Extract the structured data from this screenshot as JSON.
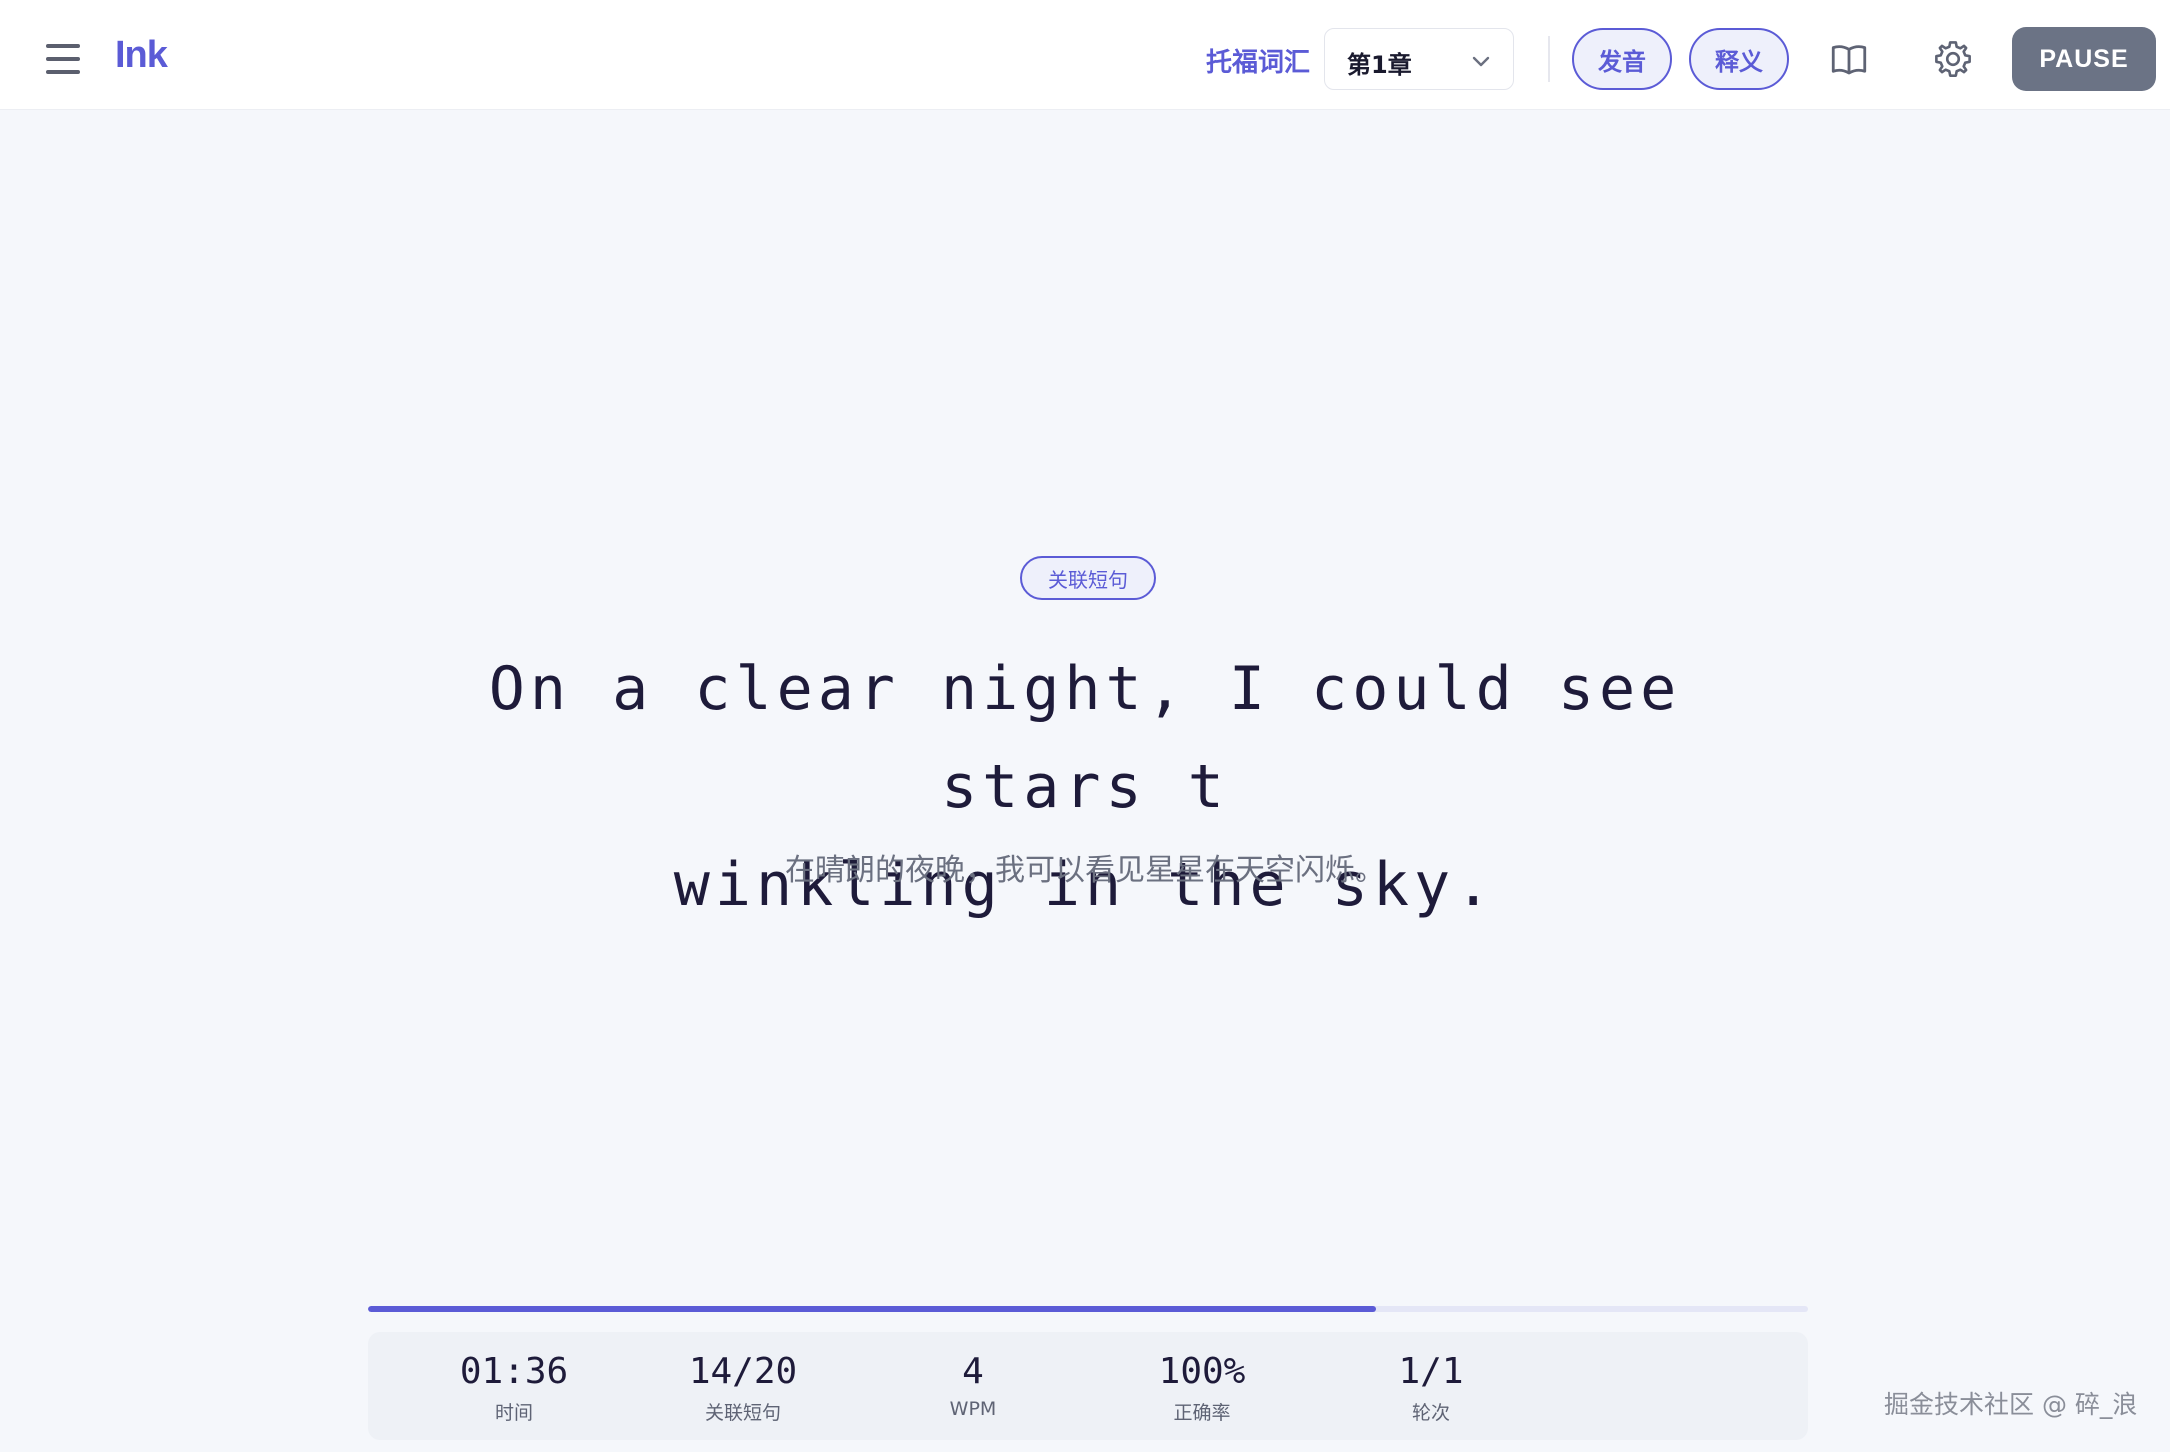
{
  "header": {
    "logo": "Ink",
    "wordbook_label": "托福词汇",
    "chapter_select": {
      "value": "第1章"
    },
    "pronounce_label": "发音",
    "definition_label": "释义",
    "pause_label": "PAUSE"
  },
  "main": {
    "tag": "关联短句",
    "sentence_line1": "On a clear night, I could see stars t",
    "sentence_line2": "winkling in the sky.",
    "translation": "在晴朗的夜晚，我可以看见星星在天空闪烁。"
  },
  "progress": {
    "fraction": 0.7
  },
  "stats": [
    {
      "value": "01:36",
      "label": "时间"
    },
    {
      "value": "14/20",
      "label": "关联短句"
    },
    {
      "value": "4",
      "label": "WPM"
    },
    {
      "value": "100%",
      "label": "正确率"
    },
    {
      "value": "1/1",
      "label": "轮次"
    }
  ],
  "watermark": "掘金技术社区 @ 碎_浪",
  "colors": {
    "accent": "#5b5bd6",
    "pause_button": "#6b7385",
    "background": "#f5f7fb"
  },
  "icons": [
    "menu-icon",
    "chevron-down-icon",
    "book-open-icon",
    "gear-icon"
  ]
}
